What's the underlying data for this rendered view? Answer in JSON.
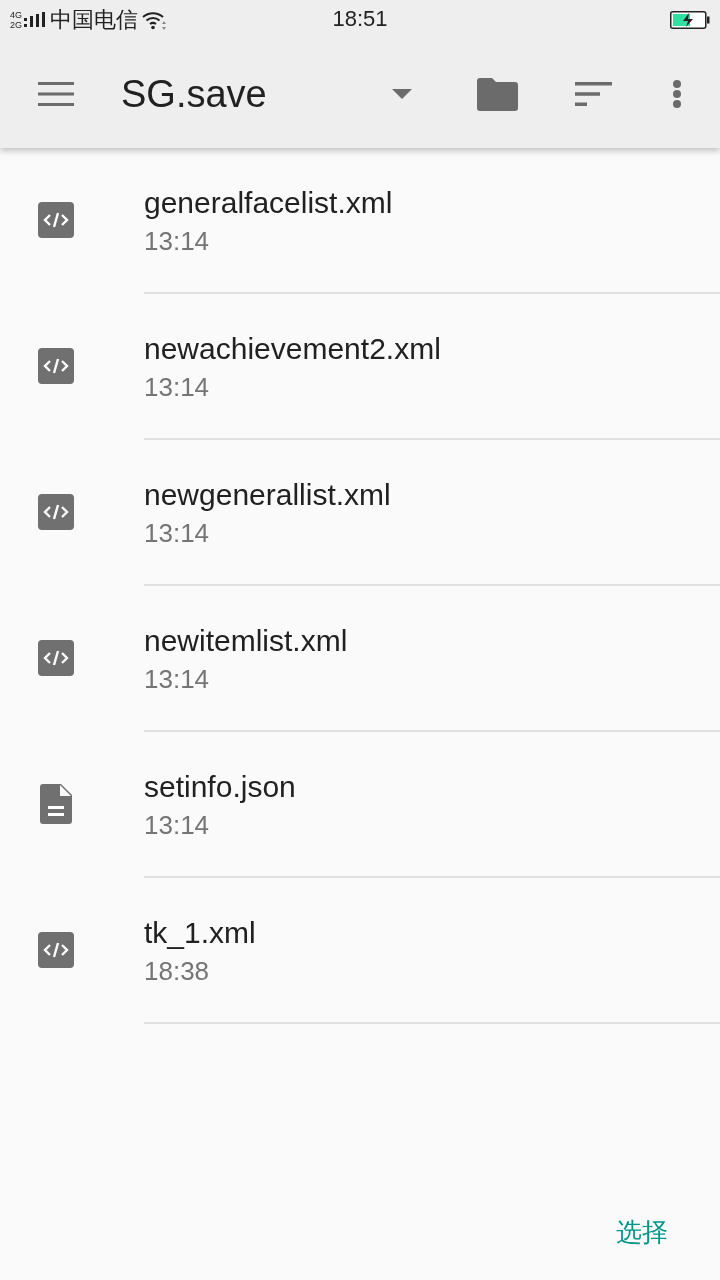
{
  "status_bar": {
    "network_top": "4G",
    "network_bottom": "2G",
    "carrier": "中国电信",
    "time": "18:51"
  },
  "toolbar": {
    "title": "SG.save"
  },
  "files": [
    {
      "kind": "code",
      "name": "generalfacelist.xml",
      "time": "13:14"
    },
    {
      "kind": "code",
      "name": "newachievement2.xml",
      "time": "13:14"
    },
    {
      "kind": "code",
      "name": "newgenerallist.xml",
      "time": "13:14"
    },
    {
      "kind": "code",
      "name": "newitemlist.xml",
      "time": "13:14"
    },
    {
      "kind": "document",
      "name": "setinfo.json",
      "time": "13:14"
    },
    {
      "kind": "code",
      "name": "tk_1.xml",
      "time": "18:38"
    }
  ],
  "action": {
    "label": "选择"
  }
}
